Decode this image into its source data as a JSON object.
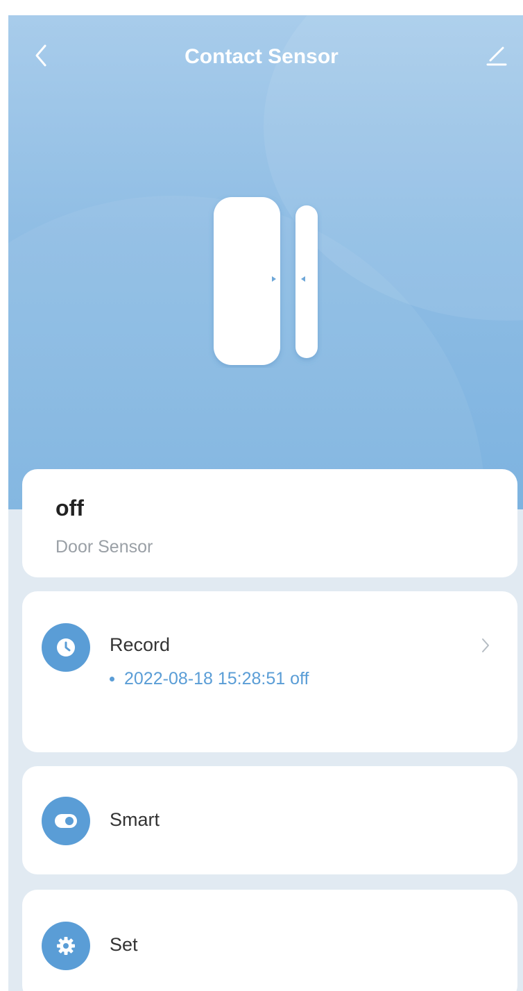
{
  "header": {
    "title": "Contact Sensor",
    "back_icon": "chevron-left-icon",
    "edit_icon": "edit-pencil-icon"
  },
  "status": {
    "value": "off",
    "device_type": "Door Sensor"
  },
  "record": {
    "label": "Record",
    "icon": "clock-icon",
    "latest_entry": "2022-08-18 15:28:51 off"
  },
  "smart": {
    "label": "Smart",
    "icon": "toggle-icon"
  },
  "set": {
    "label": "Set",
    "icon": "gear-icon"
  },
  "colors": {
    "accent": "#5a9dd6",
    "hero_top": "#a8cceb",
    "hero_bottom": "#7db3e0",
    "page_bg": "#e1eaf2"
  }
}
